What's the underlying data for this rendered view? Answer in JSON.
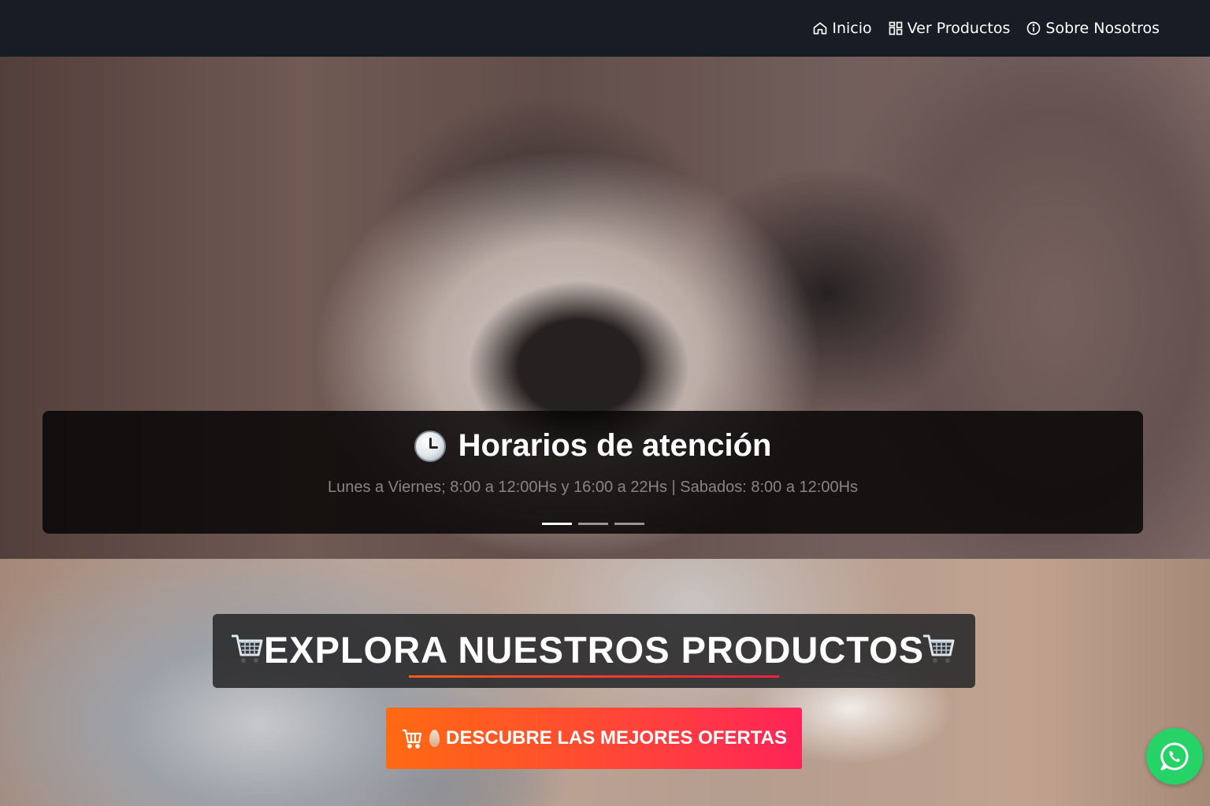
{
  "nav": {
    "items": [
      {
        "label": "Inicio",
        "icon": "home-icon"
      },
      {
        "label": "Ver Productos",
        "icon": "grid-icon"
      },
      {
        "label": "Sobre Nosotros",
        "icon": "info-icon"
      }
    ]
  },
  "hero": {
    "caption_icon": "clock-icon",
    "caption_title": "Horarios de atención",
    "caption_text": "Lunes a Viernes; 8:00 a 12:00Hs y 16:00 a 22Hs | Sabados: 8:00 a 12:00Hs",
    "slides_count": 3,
    "active_slide": 1
  },
  "products": {
    "title": "EXPLORA NUESTROS PRODUCTOS",
    "title_icon": "shopping-cart-icon",
    "offers_button": {
      "label": "DESCUBRE LAS MEJORES OFERTAS",
      "icon": "cart-icon"
    }
  },
  "whatsapp": {
    "icon": "whatsapp-icon"
  },
  "colors": {
    "navbar_bg": "#181c24",
    "button_gradient_start": "#ff6a12",
    "button_gradient_end": "#ff2458",
    "whatsapp_green": "#25d366"
  }
}
